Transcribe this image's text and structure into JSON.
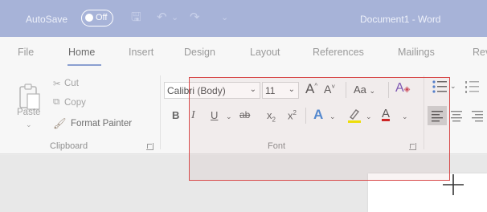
{
  "titlebar": {
    "autosave_label": "AutoSave",
    "autosave_state": "Off",
    "document_title": "Document1  -  Word",
    "save_glyph": "🖫",
    "undo_glyph": "↶",
    "redo_glyph": "↷",
    "customize_glyph": "⌄"
  },
  "tabs": [
    "File",
    "Home",
    "Insert",
    "Design",
    "Layout",
    "References",
    "Mailings",
    "Rev"
  ],
  "active_tab": "Home",
  "clipboard": {
    "paste": "Paste",
    "cut": "Cut",
    "copy": "Copy",
    "format_painter": "Format Painter",
    "group_label": "Clipboard"
  },
  "font": {
    "font_name": "Calibri (Body)",
    "font_size": "11",
    "change_case": "Aa",
    "grow": "A",
    "shrink": "A",
    "bold": "B",
    "italic": "I",
    "underline": "U",
    "strike": "ab",
    "subscript": "x",
    "superscript": "x",
    "text_effects": "A",
    "font_color": "A",
    "group_label": "Font"
  },
  "colors": {
    "titlebar": "#a7b3d8",
    "selection_border": "#d84a4a",
    "font_color_bar": "#d01f1f",
    "highlight_bar": "#f2e600",
    "accent": "#2b579a"
  }
}
